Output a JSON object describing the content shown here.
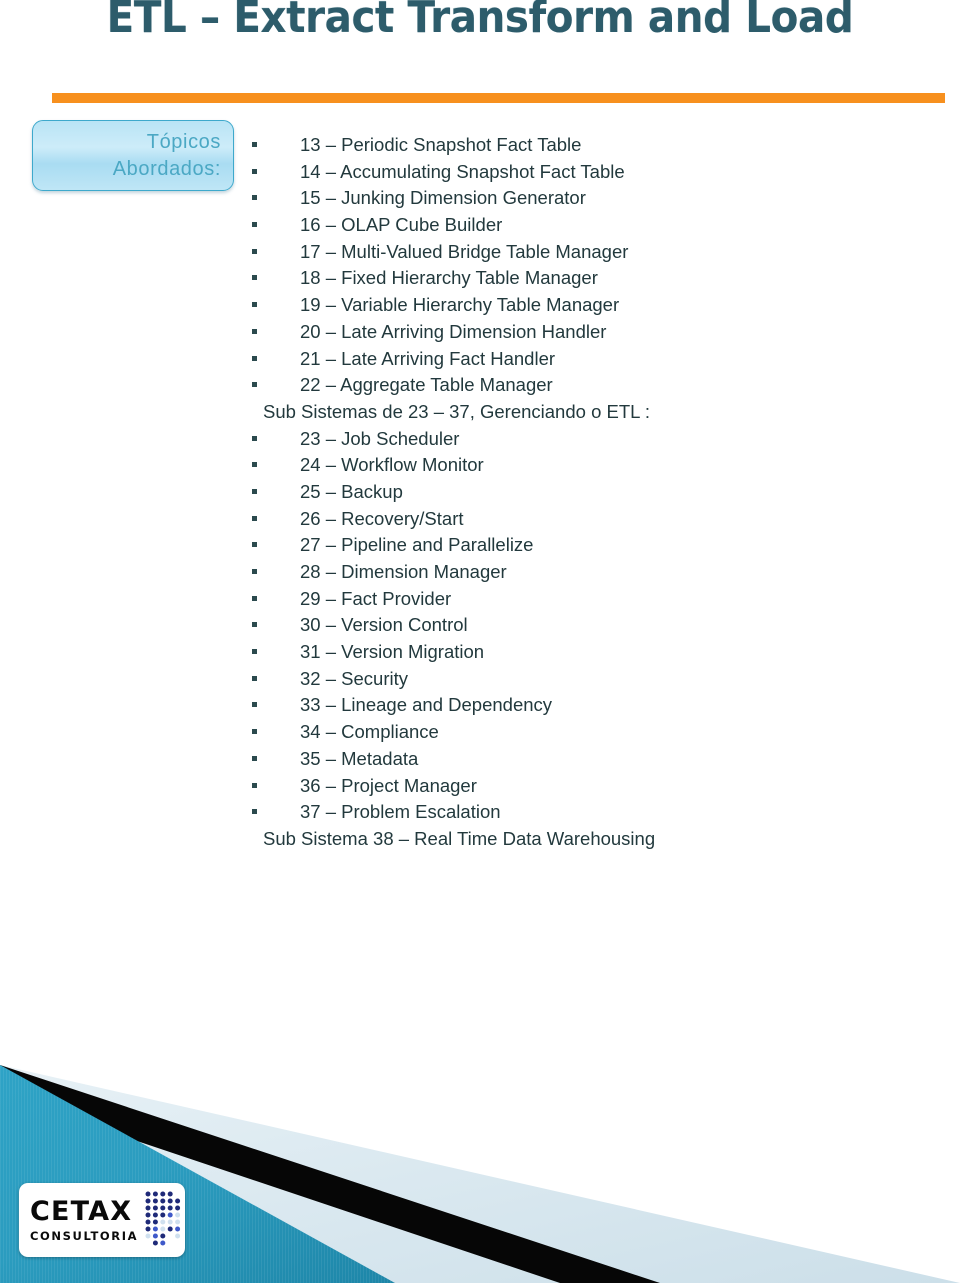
{
  "slide": {
    "title": "ETL – Extract Transform and Load",
    "title_color": "#2d5c6b",
    "rule_color": "#f7901e",
    "background": "#ffffff"
  },
  "topics_box": {
    "line1": "Tópicos",
    "line2": "Abordados:",
    "text_color": "#4ba8c4",
    "border_color": "#3ea9cc",
    "fill_color": "#bfe6f6"
  },
  "content": {
    "text_color": "#22393d",
    "bullet_color": "#2b4a4e",
    "rows": [
      {
        "type": "bullet",
        "text": "13 – Periodic Snapshot Fact Table"
      },
      {
        "type": "bullet",
        "text": "14 – Accumulating Snapshot Fact Table"
      },
      {
        "type": "bullet",
        "text": "15 – Junking Dimension Generator"
      },
      {
        "type": "bullet",
        "text": "16 – OLAP Cube Builder"
      },
      {
        "type": "bullet",
        "text": "17 – Multi-Valued Bridge Table Manager"
      },
      {
        "type": "bullet",
        "text": "18 – Fixed Hierarchy Table Manager"
      },
      {
        "type": "bullet",
        "text": "19 – Variable Hierarchy Table Manager"
      },
      {
        "type": "bullet",
        "text": "20 – Late Arriving Dimension Handler"
      },
      {
        "type": "bullet",
        "text": "21 – Late Arriving Fact Handler"
      },
      {
        "type": "bullet",
        "text": "22 – Aggregate Table Manager"
      },
      {
        "type": "heading",
        "text": "Sub Sistemas de 23 – 37, Gerenciando o ETL :"
      },
      {
        "type": "bullet",
        "text": "23 – Job Scheduler"
      },
      {
        "type": "bullet",
        "text": "24 – Workflow Monitor"
      },
      {
        "type": "bullet",
        "text": "25 – Backup"
      },
      {
        "type": "bullet",
        "text": "26 – Recovery/Start"
      },
      {
        "type": "bullet",
        "text": "27 – Pipeline and Parallelize"
      },
      {
        "type": "bullet",
        "text": "28 – Dimension Manager"
      },
      {
        "type": "bullet",
        "text": "29 – Fact Provider"
      },
      {
        "type": "bullet",
        "text": "30 – Version Control"
      },
      {
        "type": "bullet",
        "text": "31 – Version Migration"
      },
      {
        "type": "bullet",
        "text": "32 – Security"
      },
      {
        "type": "bullet",
        "text": "33 – Lineage and Dependency"
      },
      {
        "type": "bullet",
        "text": "34 – Compliance"
      },
      {
        "type": "bullet",
        "text": "35 – Metadata"
      },
      {
        "type": "bullet",
        "text": "36 – Project Manager"
      },
      {
        "type": "bullet",
        "text": "37 – Problem Escalation"
      },
      {
        "type": "heading",
        "text": "Sub Sistema 38 – Real Time Data Warehousing"
      }
    ]
  },
  "footer": {
    "teal_color": "#2b9cbf",
    "teal_dark": "#1b7e9e",
    "black_color": "#060606",
    "pale_color": "#dbe9f0"
  },
  "logo": {
    "name": "CETAX",
    "tagline": "CONSULTORIA",
    "text_color": "#0a0a0a",
    "dot_dark": "#1f2a78",
    "dot_mid": "#3f59c9",
    "dot_light": "#cfe0ef"
  }
}
